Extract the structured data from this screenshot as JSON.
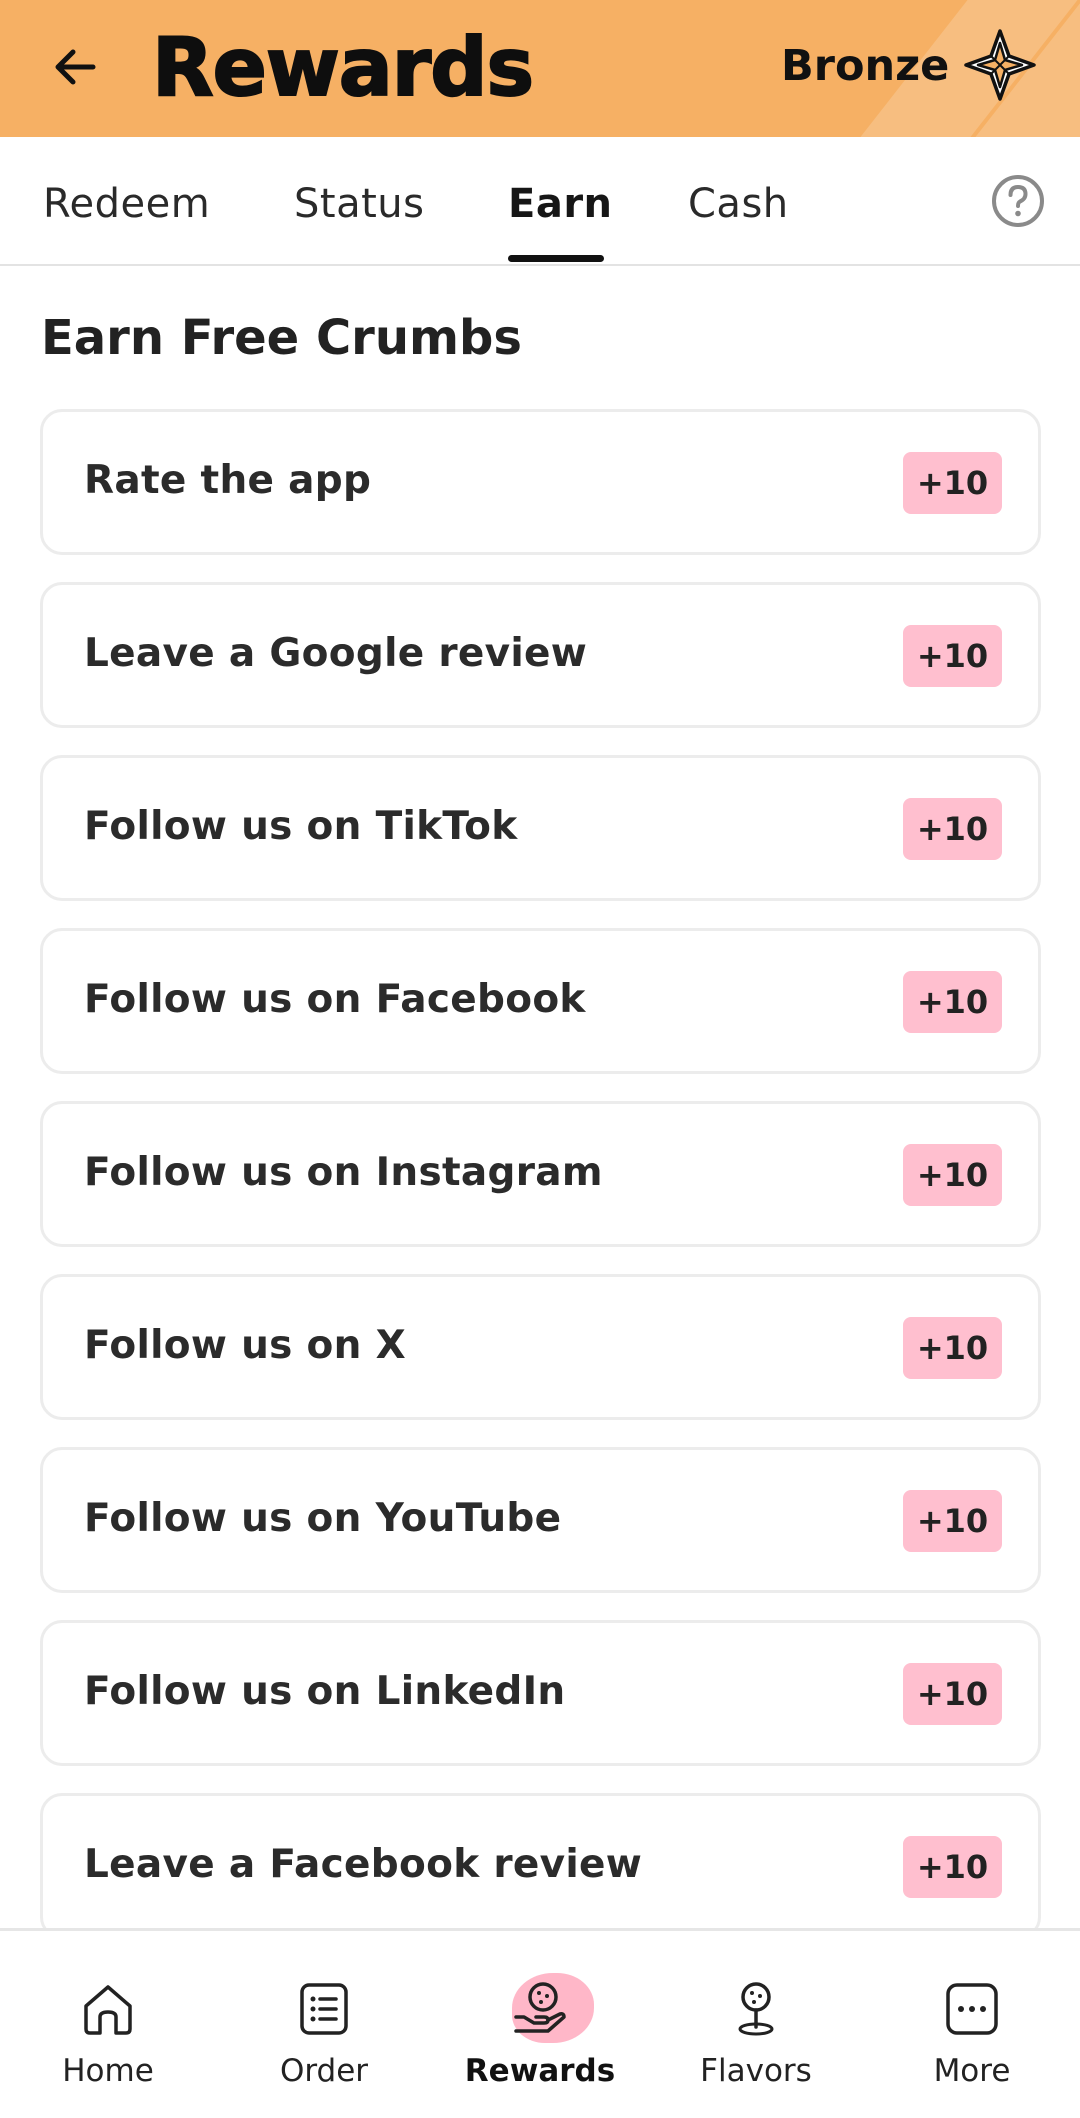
{
  "header": {
    "title": "Rewards",
    "tier": "Bronze",
    "back_icon": "arrow-left-icon",
    "tier_icon": "sparkle-star-icon",
    "background_color": "#f6b064"
  },
  "tabs": [
    {
      "label": "Redeem",
      "active": false
    },
    {
      "label": "Status",
      "active": false
    },
    {
      "label": "Earn",
      "active": true
    },
    {
      "label": "Cash",
      "active": false
    }
  ],
  "help_icon": "question-circle-icon",
  "section": {
    "title": "Earn Free Crumbs"
  },
  "earn_items": [
    {
      "label": "Rate the app",
      "points": "+10"
    },
    {
      "label": "Leave a Google review",
      "points": "+10"
    },
    {
      "label": "Follow us on TikTok",
      "points": "+10"
    },
    {
      "label": "Follow us on Facebook",
      "points": "+10"
    },
    {
      "label": "Follow us on Instagram",
      "points": "+10"
    },
    {
      "label": "Follow us on X",
      "points": "+10"
    },
    {
      "label": "Follow us on YouTube",
      "points": "+10"
    },
    {
      "label": "Follow us on LinkedIn",
      "points": "+10"
    },
    {
      "label": "Leave a Facebook review",
      "points": "+10"
    }
  ],
  "badge_color": "#ffbfcf",
  "bottom_nav": [
    {
      "label": "Home",
      "icon": "home-icon",
      "active": false
    },
    {
      "label": "Order",
      "icon": "list-icon",
      "active": false
    },
    {
      "label": "Rewards",
      "icon": "cookie-hand-icon",
      "active": true
    },
    {
      "label": "Flavors",
      "icon": "cookie-pin-icon",
      "active": false
    },
    {
      "label": "More",
      "icon": "more-dots-icon",
      "active": false
    }
  ]
}
